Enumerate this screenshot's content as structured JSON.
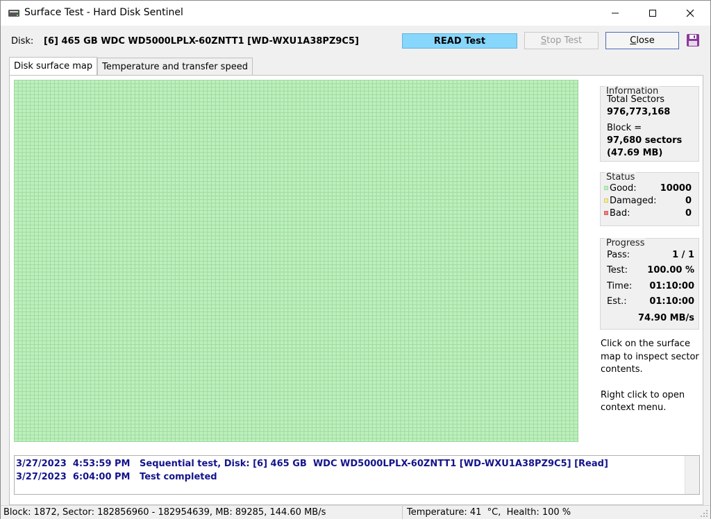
{
  "window": {
    "title": "Surface Test - Hard Disk Sentinel",
    "icon": "hdd-icon"
  },
  "disk_row": {
    "label": "Disk:",
    "value": "[6] 465 GB  WDC WD5000LPLX-60ZNTT1 [WD-WXU1A38PZ9C5]",
    "mode": "READ Test",
    "stop_label": "Stop Test",
    "close_label": "Close",
    "accent_color": "#87d6fb"
  },
  "tabs": [
    {
      "label": "Disk surface map",
      "active": true
    },
    {
      "label": "Temperature and transfer speed",
      "active": false
    }
  ],
  "surface_map": {
    "cell_color": "#bdf0bd",
    "grid_color": "#9fd99f"
  },
  "information": {
    "title": "Information",
    "total_sectors_label": "Total Sectors",
    "total_sectors_value": "976,773,168",
    "block_label": "Block =",
    "block_value": "97,680 sectors",
    "block_mb": "(47.69 MB)"
  },
  "status": {
    "title": "Status",
    "good_label": "Good:",
    "good_value": "10000",
    "damaged_label": "Damaged:",
    "damaged_value": "0",
    "bad_label": "Bad:",
    "bad_value": "0",
    "colors": {
      "good": "#bdf0bd",
      "damaged": "#f5eba0",
      "bad": "#f08080"
    }
  },
  "progress": {
    "title": "Progress",
    "pass_label": "Pass:",
    "pass_value": "1 / 1",
    "test_label": "Test:",
    "test_value": "100.00 %",
    "time_label": "Time:",
    "time_value": "01:10:00",
    "est_label": "Est.:",
    "est_value": "01:10:00",
    "speed": "74.90 MB/s"
  },
  "help": {
    "line1": "Click on the surface",
    "line2": "map to inspect sector",
    "line3": "contents.",
    "line4": "Right click to open",
    "line5": "context menu."
  },
  "log": [
    "3/27/2023  4:53:59 PM   Sequential test, Disk: [6] 465 GB  WDC WD5000LPLX-60ZNTT1 [WD-WXU1A38PZ9C5] [Read]",
    "3/27/2023  6:04:00 PM   Test completed"
  ],
  "statusbar": {
    "left": "Block: 1872, Sector: 182856960 - 182954639, MB: 89285, 144.60 MB/s",
    "right": "Temperature: 41  °C,  Health: 100 %"
  }
}
